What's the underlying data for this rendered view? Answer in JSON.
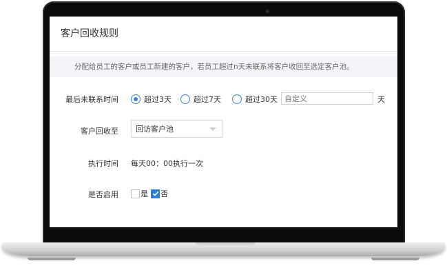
{
  "page": {
    "title": "客户回收规则",
    "notice": "分配给员工的客户或员工新建的客户，若员工超过n天未联系将客户收回至选定客户池。"
  },
  "rules": {
    "last_contact": {
      "label": "最后未联系时间",
      "options": [
        "超过3天",
        "超过7天",
        "超过30天"
      ],
      "selected": "超过3天",
      "custom_placeholder": "自定义",
      "unit": "天"
    },
    "recycle_to": {
      "label": "客户回收至",
      "value": "回访客户池"
    },
    "exec_time": {
      "label": "执行时间",
      "value": "每天00：00执行一次"
    },
    "enabled": {
      "label": "是否启用",
      "yes_label": "是",
      "no_label": "否",
      "selected": "否"
    }
  },
  "colors": {
    "accent": "#3a85d8",
    "notice_bg": "#f3f5f8"
  }
}
